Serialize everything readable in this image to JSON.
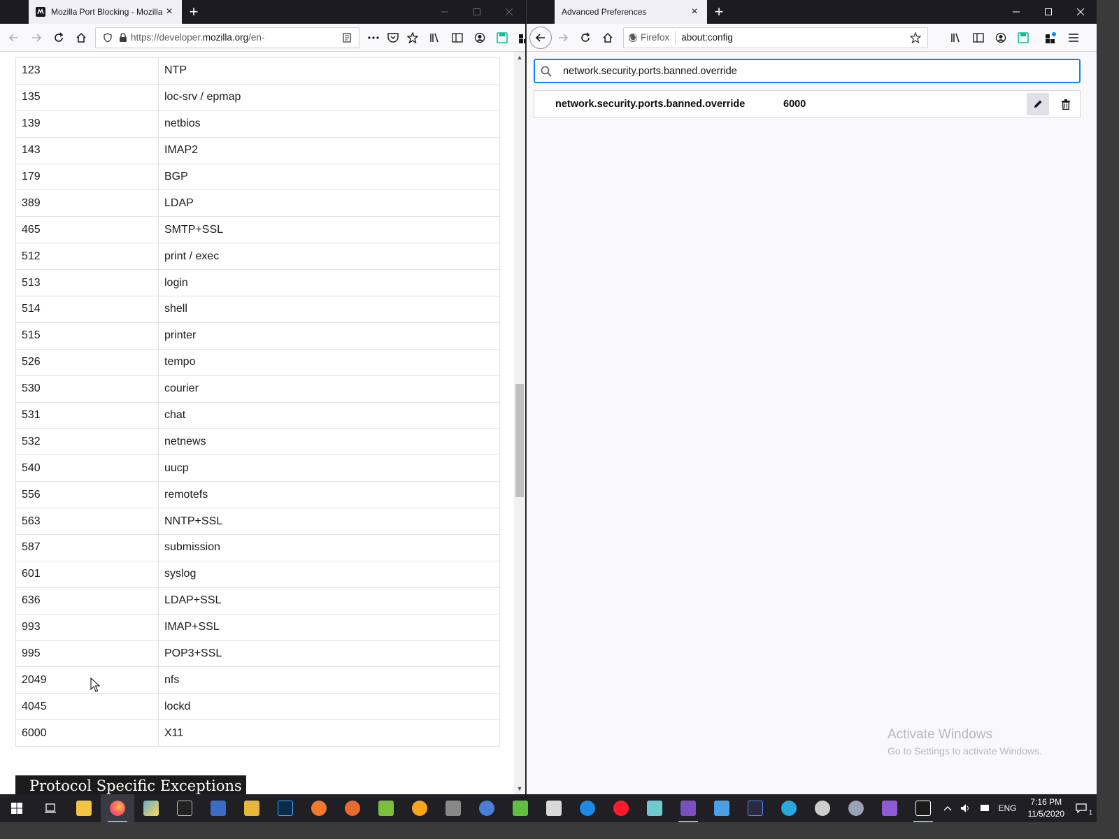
{
  "left_window": {
    "tab_title": "Mozilla Port Blocking - Mozilla",
    "url_host_prefix": "https://developer.",
    "url_host_domain": "mozilla.org",
    "url_path": "/en-",
    "ports": [
      {
        "port": "123",
        "service": "NTP"
      },
      {
        "port": "135",
        "service": "loc-srv / epmap"
      },
      {
        "port": "139",
        "service": "netbios"
      },
      {
        "port": "143",
        "service": "IMAP2"
      },
      {
        "port": "179",
        "service": "BGP"
      },
      {
        "port": "389",
        "service": "LDAP"
      },
      {
        "port": "465",
        "service": "SMTP+SSL"
      },
      {
        "port": "512",
        "service": "print / exec"
      },
      {
        "port": "513",
        "service": "login"
      },
      {
        "port": "514",
        "service": "shell"
      },
      {
        "port": "515",
        "service": "printer"
      },
      {
        "port": "526",
        "service": "tempo"
      },
      {
        "port": "530",
        "service": "courier"
      },
      {
        "port": "531",
        "service": "chat"
      },
      {
        "port": "532",
        "service": "netnews"
      },
      {
        "port": "540",
        "service": "uucp"
      },
      {
        "port": "556",
        "service": "remotefs"
      },
      {
        "port": "563",
        "service": "NNTP+SSL"
      },
      {
        "port": "587",
        "service": "submission"
      },
      {
        "port": "601",
        "service": "syslog"
      },
      {
        "port": "636",
        "service": "LDAP+SSL"
      },
      {
        "port": "993",
        "service": "IMAP+SSL"
      },
      {
        "port": "995",
        "service": "POP3+SSL"
      },
      {
        "port": "2049",
        "service": "nfs"
      },
      {
        "port": "4045",
        "service": "lockd"
      },
      {
        "port": "6000",
        "service": "X11"
      }
    ],
    "section_heading": "Protocol Specific Exceptions"
  },
  "right_window": {
    "tab_title": "Advanced Preferences",
    "identity_label": "Firefox",
    "url": "about:config",
    "search_value": "network.security.ports.banned.override",
    "pref_name": "network.security.ports.banned.override",
    "pref_value": "6000",
    "activate_title": "Activate Windows",
    "activate_subtitle": "Go to Settings to activate Windows."
  },
  "taskbar": {
    "language": "ENG",
    "time": "7:16 PM",
    "date": "11/5/2020",
    "notification_count": "1"
  },
  "colors": {
    "accent": "#0a84ff",
    "titlebar": "#1c1b22",
    "taskbar": "#1f1f24",
    "heading_bg": "#1b1b1b"
  }
}
